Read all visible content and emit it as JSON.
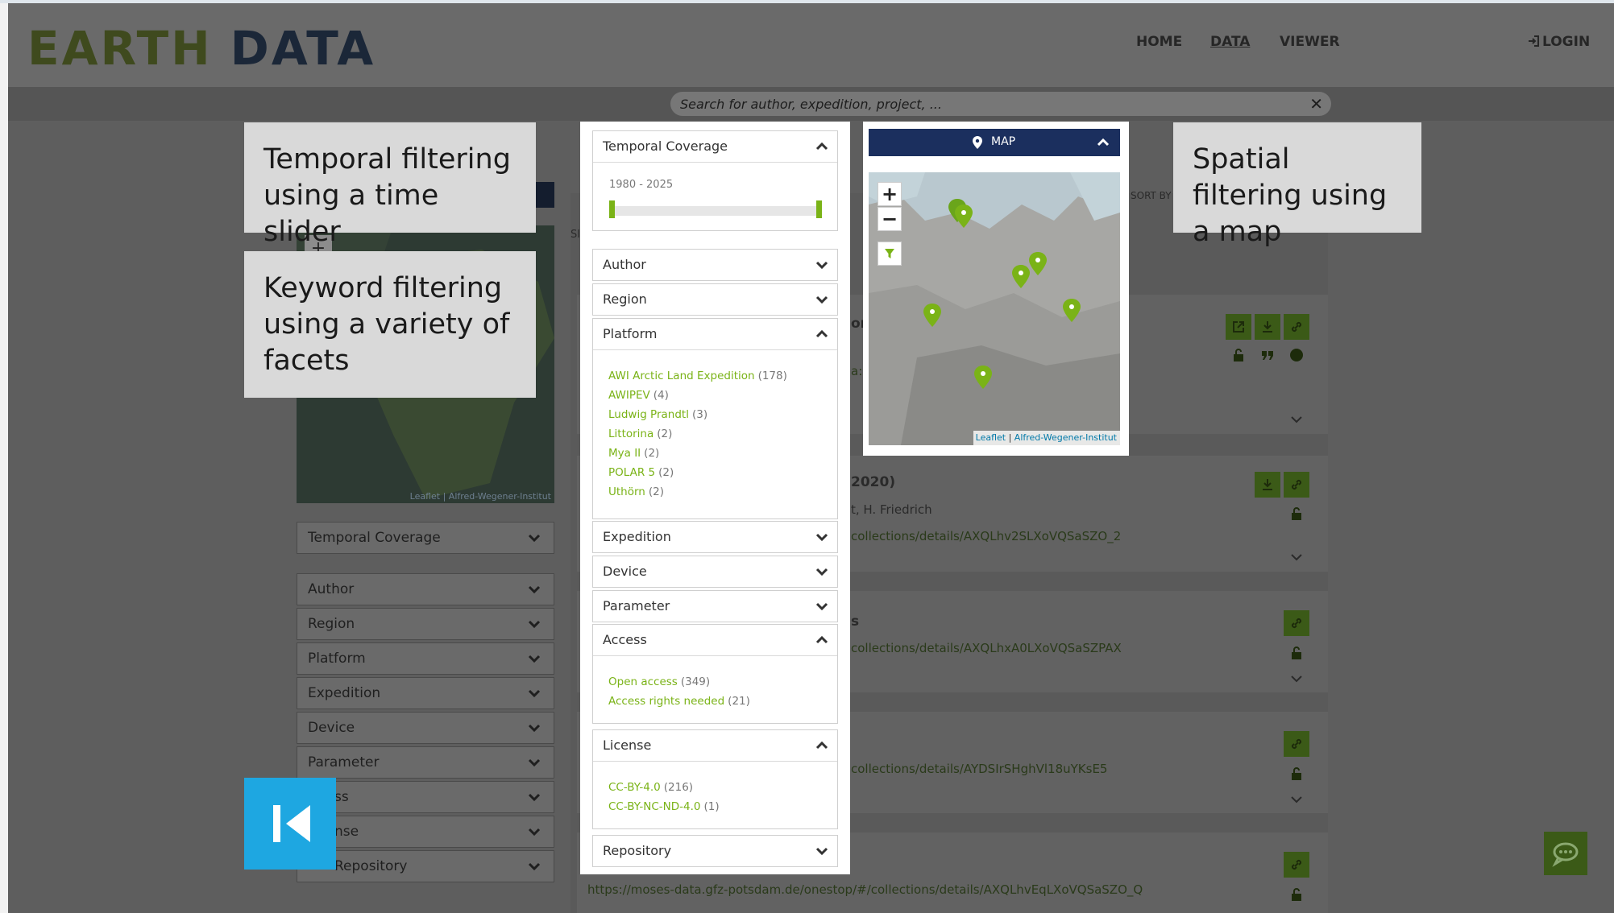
{
  "header": {
    "logo_word1": "EARTH",
    "logo_word2": "DATA",
    "nav": [
      {
        "label": "HOME"
      },
      {
        "label": "DATA"
      },
      {
        "label": "VIEWER"
      }
    ],
    "login_label": "LOGIN"
  },
  "search": {
    "placeholder": "Search for author, expedition, project, ...",
    "clear_icon": "close-icon"
  },
  "callouts": {
    "temporal": "Temporal filtering using a time slider",
    "keyword": "Keyword filtering using a variety of facets",
    "spatial": "Spatial filtering using a map"
  },
  "filter_panel": {
    "temporal": {
      "label": "Temporal Coverage",
      "range_text": "1980 - 2025",
      "range_start_year": 1980,
      "range_end_year": 2025,
      "expanded": true
    },
    "author": {
      "label": "Author",
      "expanded": false
    },
    "region": {
      "label": "Region",
      "expanded": false
    },
    "platform": {
      "label": "Platform",
      "expanded": true,
      "items": [
        {
          "name": "AWI Arctic Land Expedition",
          "count": "(178)"
        },
        {
          "name": "AWIPEV",
          "count": "(4)"
        },
        {
          "name": "Ludwig Prandtl",
          "count": "(3)"
        },
        {
          "name": "Littorina",
          "count": "(2)"
        },
        {
          "name": "Mya II",
          "count": "(2)"
        },
        {
          "name": "POLAR 5",
          "count": "(2)"
        },
        {
          "name": "Uthörn",
          "count": "(2)"
        }
      ]
    },
    "expedition": {
      "label": "Expedition",
      "expanded": false
    },
    "device": {
      "label": "Device",
      "expanded": false
    },
    "parameter": {
      "label": "Parameter",
      "expanded": false
    },
    "access": {
      "label": "Access",
      "expanded": true,
      "items": [
        {
          "name": "Open access",
          "count": "(349)"
        },
        {
          "name": "Access rights needed",
          "count": "(21)"
        }
      ]
    },
    "license": {
      "label": "License",
      "expanded": true,
      "items": [
        {
          "name": "CC-BY-4.0",
          "count": "(216)"
        },
        {
          "name": "CC-BY-NC-ND-4.0",
          "count": "(1)"
        }
      ]
    },
    "repository": {
      "label": "Repository",
      "expanded": false
    }
  },
  "map_card": {
    "title": "MAP",
    "zoom_in": "+",
    "zoom_out": "−",
    "attribution_leaflet": "Leaflet",
    "attribution_sep": " | ",
    "attribution_awi": "Alfred-Wegener-Institut"
  },
  "bg_sidebar": {
    "facets": [
      {
        "label": "Temporal Coverage"
      },
      {
        "label": "Author"
      },
      {
        "label": "Region"
      },
      {
        "label": "Platform"
      },
      {
        "label": "Expedition"
      },
      {
        "label": "Device"
      },
      {
        "label": "Parameter"
      },
      {
        "label": "ss"
      },
      {
        "label": "nse"
      },
      {
        "label": "Repository"
      }
    ],
    "map_attribution": "Leaflet | Alfred-Wegener-Institut",
    "zoom_in": "+"
  },
  "results": {
    "sort_label": "SORT BY",
    "stray_s": "Sl",
    "card1_frag": "on",
    "card1_frag2": "a:",
    "card2_title_frag": "2020)",
    "card2_authors_frag": "t, H. Friedrich",
    "card2_link": "collections/details/AXQLhv2SLXoVQSaSZO_2",
    "card3_title_frag": "s",
    "card3_link": "collections/details/AXQLhxA0LXoVQSaSZPAX",
    "card4_link": "collections/details/AYDSIrSHghVl18uYKsE5",
    "card5_link": "https://moses-data.gfz-potsdam.de/onestop/#/collections/details/AXQLhvEqLXoVQSaSZO_Q"
  },
  "colors": {
    "accent_green": "#7ab317",
    "map_bar_navy": "#1b2f5e",
    "back_button_blue": "#1ea7e1",
    "dim_overlay": "#5e5e5e"
  },
  "icons": {
    "back": "skip-back-icon",
    "chat": "chat-icon",
    "login": "sign-in-icon",
    "map_pin": "map-pin-icon",
    "filter": "filter-icon"
  }
}
